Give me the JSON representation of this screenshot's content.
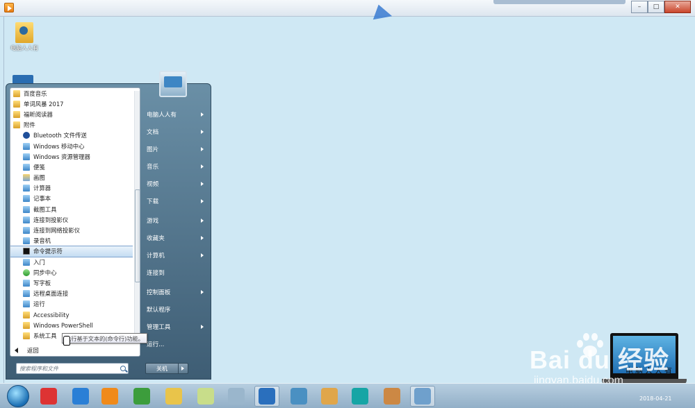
{
  "desktop": {
    "icons": [
      {
        "label": "电脑人人有"
      }
    ]
  },
  "start_menu": {
    "programs": [
      {
        "label": "百度音乐",
        "icon": "folder-icon",
        "sub": false
      },
      {
        "label": "单词风暴 2017",
        "icon": "folder-icon",
        "sub": false
      },
      {
        "label": "福昕阅读器",
        "icon": "folder-icon",
        "sub": false
      },
      {
        "label": "附件",
        "icon": "folder-icon",
        "sub": false
      },
      {
        "label": "Bluetooth 文件传送",
        "icon": "bluetooth-icon",
        "sub": true
      },
      {
        "label": "Windows 移动中心",
        "icon": "app-icon",
        "sub": true
      },
      {
        "label": "Windows 资源管理器",
        "icon": "explorer-icon",
        "sub": true
      },
      {
        "label": "便笺",
        "icon": "sticky-notes-icon",
        "sub": true
      },
      {
        "label": "画图",
        "icon": "paint-icon",
        "sub": true
      },
      {
        "label": "计算器",
        "icon": "calculator-icon",
        "sub": true
      },
      {
        "label": "记事本",
        "icon": "notepad-icon",
        "sub": true
      },
      {
        "label": "截图工具",
        "icon": "snipping-icon",
        "sub": true
      },
      {
        "label": "连接到投影仪",
        "icon": "projector-icon",
        "sub": true
      },
      {
        "label": "连接到网络投影仪",
        "icon": "network-projector-icon",
        "sub": true
      },
      {
        "label": "录音机",
        "icon": "microphone-icon",
        "sub": true
      },
      {
        "label": "命令提示符",
        "icon": "cmd-icon",
        "sub": true,
        "selected": true
      },
      {
        "label": "入门",
        "icon": "app-icon",
        "sub": true
      },
      {
        "label": "同步中心",
        "icon": "sync-icon",
        "sub": true
      },
      {
        "label": "写字板",
        "icon": "wordpad-icon",
        "sub": true
      },
      {
        "label": "远程桌面连接",
        "icon": "remote-desktop-icon",
        "sub": true
      },
      {
        "label": "运行",
        "icon": "run-icon",
        "sub": true
      },
      {
        "label": "Accessibility",
        "icon": "folder-icon",
        "sub": true
      },
      {
        "label": "Windows PowerShell",
        "icon": "folder-icon",
        "sub": true
      },
      {
        "label": "系统工具",
        "icon": "folder-icon",
        "sub": true
      }
    ],
    "back_label": "返回",
    "search_placeholder": "搜索程序和文件",
    "tooltip": "执行基于文本的(命令行)功能。",
    "right_items": [
      {
        "label": "电脑人人有",
        "arrow": true
      },
      {
        "label": "文档",
        "arrow": true
      },
      {
        "label": "图片",
        "arrow": true
      },
      {
        "label": "音乐",
        "arrow": true
      },
      {
        "label": "视频",
        "arrow": true
      },
      {
        "label": "下载",
        "arrow": true
      },
      {
        "label": "游戏",
        "arrow": true
      },
      {
        "label": "收藏夹",
        "arrow": true
      },
      {
        "label": "计算机",
        "arrow": true
      },
      {
        "label": "连接到",
        "arrow": false
      },
      {
        "label": "控制面板",
        "arrow": true
      },
      {
        "label": "默认程序",
        "arrow": false
      },
      {
        "label": "管理工具",
        "arrow": true
      },
      {
        "label": "运行...",
        "arrow": false
      }
    ],
    "shutdown_label": "关机"
  },
  "taskbar": {
    "icons": [
      "start-orb",
      "pinyin-icon",
      "ie-icon",
      "media-player-icon",
      "chrome-icon",
      "explorer-icon",
      "notes-icon",
      "doc-icon",
      "browser-icon",
      "remote-icon",
      "fan-icon",
      "headset-icon",
      "paint-icon",
      "window-icon"
    ]
  },
  "watermark": {
    "brand": "Bai du 经验",
    "url": "jingyan.baidu.com",
    "laptop_text": "电脑人人有",
    "date": "2018-04-21"
  },
  "colors": {
    "desktop_bg": "#cfe8f4",
    "start_menu_right": "#4f6f86",
    "selected_item": "#c4dcf2"
  }
}
